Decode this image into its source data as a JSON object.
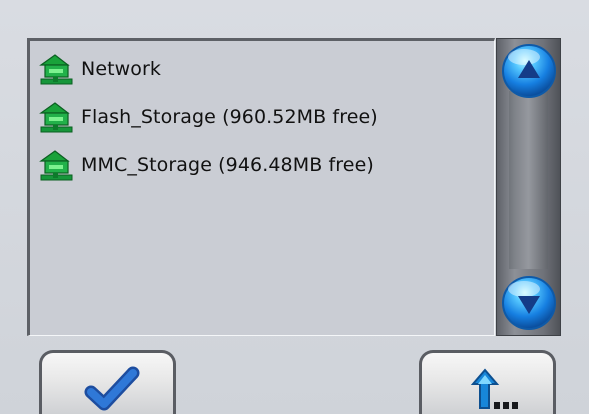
{
  "file_browser": {
    "items": [
      {
        "label": "Network",
        "icon": "network-drive-icon"
      },
      {
        "label": "Flash_Storage (960.52MB free)",
        "icon": "storage-drive-icon"
      },
      {
        "label": "MMC_Storage (946.48MB free)",
        "icon": "storage-drive-icon"
      }
    ]
  },
  "scrollbar": {
    "up_icon": "scroll-up-icon",
    "down_icon": "scroll-down-icon"
  },
  "buttons": {
    "confirm_icon": "checkmark-icon",
    "up_folder_icon": "up-folder-icon"
  },
  "colors": {
    "panel_background": "#cacdd4",
    "drive_icon": "#1d9a34",
    "scroll_blue": "#2d8ee8",
    "checkmark_blue": "#2f67c8"
  }
}
